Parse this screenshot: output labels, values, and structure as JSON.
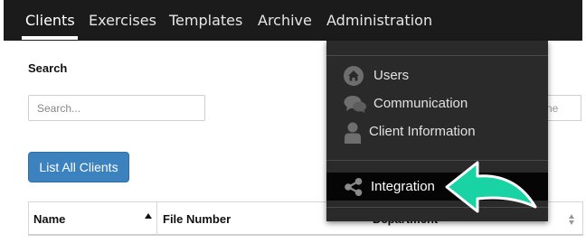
{
  "nav": {
    "items": [
      {
        "label": "Clients",
        "active": true
      },
      {
        "label": "Exercises"
      },
      {
        "label": "Templates"
      },
      {
        "label": "Archive"
      },
      {
        "label": "Administration"
      }
    ]
  },
  "search": {
    "heading": "Search",
    "placeholder": "Search...",
    "partial_field_text": "ne"
  },
  "actions": {
    "list_all_label": "List All Clients"
  },
  "table": {
    "columns": [
      "Name",
      "File Number",
      "Department"
    ]
  },
  "admin_menu": {
    "items": [
      {
        "label": "Users",
        "icon": "home-icon"
      },
      {
        "label": "Communication",
        "icon": "chat-bubbles-icon"
      },
      {
        "label": "Client Information",
        "icon": "person-icon"
      },
      {
        "label": "Integration",
        "icon": "share-icon",
        "highlighted": true
      }
    ]
  },
  "colors": {
    "navbar": "#1b1b1b",
    "dropdown": "#2a2a2a",
    "button": "#3b82bf",
    "callout_arrow": "#19d3a5"
  }
}
